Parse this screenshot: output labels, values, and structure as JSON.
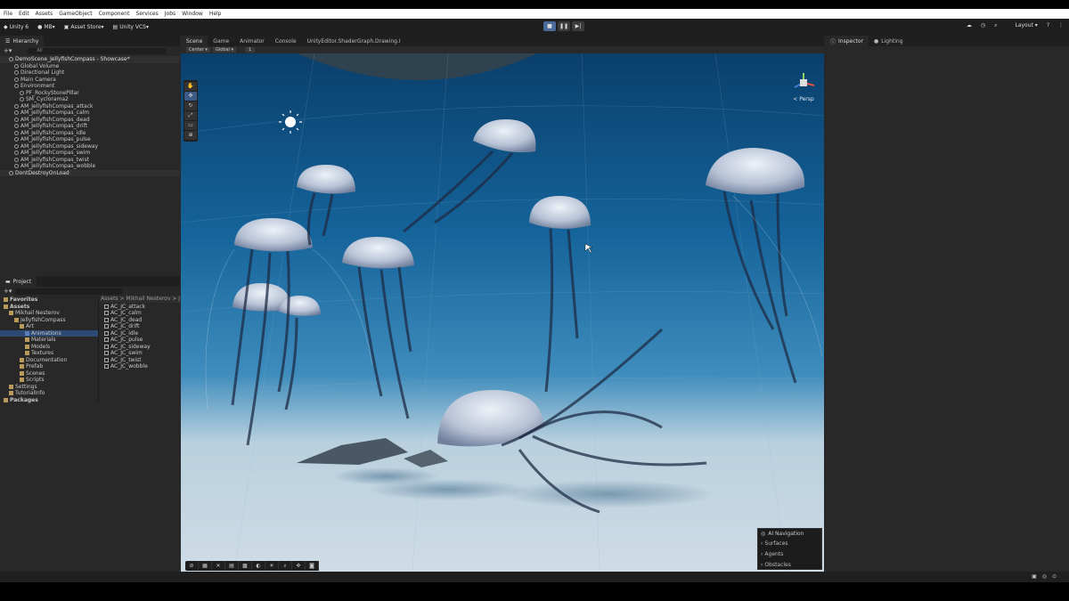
{
  "menu": [
    "File",
    "Edit",
    "Assets",
    "GameObject",
    "Component",
    "Services",
    "Jobs",
    "Window",
    "Help"
  ],
  "toolbar": {
    "version": "Unity 6",
    "account": "MB",
    "store": "Asset Store",
    "vcs": "Unity VCS",
    "layout": "Layout"
  },
  "hierarchy": {
    "tab": "Hierarchy",
    "search_placeholder": "All",
    "items": [
      {
        "label": "DemoScene_JellyfishCompass - Showcase*",
        "depth": 0,
        "kind": "scene"
      },
      {
        "label": "Global Volume",
        "depth": 1,
        "kind": "obj"
      },
      {
        "label": "Directional Light",
        "depth": 1,
        "kind": "obj"
      },
      {
        "label": "Main Camera",
        "depth": 1,
        "kind": "obj"
      },
      {
        "label": "Environment",
        "depth": 1,
        "kind": "obj"
      },
      {
        "label": "PF_RockyStonePillar",
        "depth": 2,
        "kind": "obj"
      },
      {
        "label": "SM_Cyclorama2",
        "depth": 2,
        "kind": "obj"
      },
      {
        "label": "AM_JellyfishCompas_attack",
        "depth": 1,
        "kind": "obj"
      },
      {
        "label": "AM_JellyfishCompas_calm",
        "depth": 1,
        "kind": "obj"
      },
      {
        "label": "AM_JellyfishCompas_dead",
        "depth": 1,
        "kind": "obj"
      },
      {
        "label": "AM_JellyfishCompas_drift",
        "depth": 1,
        "kind": "obj"
      },
      {
        "label": "AM_JellyfishCompas_idle",
        "depth": 1,
        "kind": "obj"
      },
      {
        "label": "AM_JellyfishCompas_pulse",
        "depth": 1,
        "kind": "obj"
      },
      {
        "label": "AM_JellyfishCompas_sideway",
        "depth": 1,
        "kind": "obj"
      },
      {
        "label": "AM_JellyfishCompas_swim",
        "depth": 1,
        "kind": "obj"
      },
      {
        "label": "AM_JellyfishCompas_twist",
        "depth": 1,
        "kind": "obj"
      },
      {
        "label": "AM_JellyfishCompas_wobble",
        "depth": 1,
        "kind": "obj"
      },
      {
        "label": "DontDestroyOnLoad",
        "depth": 0,
        "kind": "scene"
      }
    ]
  },
  "project": {
    "tab": "Project",
    "tree": [
      {
        "label": "Favorites",
        "depth": 0,
        "bold": true
      },
      {
        "label": "Assets",
        "depth": 0,
        "bold": true
      },
      {
        "label": "Mikhail Nesterov",
        "depth": 1
      },
      {
        "label": "JellyfishCompass",
        "depth": 2
      },
      {
        "label": "Art",
        "depth": 3
      },
      {
        "label": "Animations",
        "depth": 4,
        "selected": true
      },
      {
        "label": "Materials",
        "depth": 4
      },
      {
        "label": "Models",
        "depth": 4
      },
      {
        "label": "Textures",
        "depth": 4
      },
      {
        "label": "Documentation",
        "depth": 3
      },
      {
        "label": "Prefab",
        "depth": 3
      },
      {
        "label": "Scenes",
        "depth": 3
      },
      {
        "label": "Scripts",
        "depth": 3
      },
      {
        "label": "Settings",
        "depth": 1
      },
      {
        "label": "TutorialInfo",
        "depth": 1
      },
      {
        "label": "Packages",
        "depth": 0,
        "bold": true
      }
    ],
    "breadcrumb": "Assets > Mikhail Nesterov > J",
    "files": [
      "AC_JC_attack",
      "AC_JC_calm",
      "AC_JC_dead",
      "AC_JC_drift",
      "AC_JC_idle",
      "AC_JC_pulse",
      "AC_JC_sideway",
      "AC_JC_swim",
      "AC_JC_twist",
      "AC_JC_wobble"
    ]
  },
  "scene_tabs": [
    "Scene",
    "Game",
    "Animator",
    "Console",
    "UnityEditor.ShaderGraph.Drawing.I"
  ],
  "scene_toolbar": {
    "pivot": "Center",
    "space": "Global",
    "snap": "1"
  },
  "gizmo": {
    "label": "< Persp"
  },
  "ai_nav": {
    "title": "AI Navigation",
    "items": [
      "Surfaces",
      "Agents",
      "Obstacles"
    ]
  },
  "right_tabs": [
    "Inspector",
    "Lighting"
  ],
  "colors": {
    "water_top": "#0b4a78",
    "water_mid": "#1c6aa0",
    "sand": "#c7d7e2",
    "accent": "#3c5a86"
  }
}
